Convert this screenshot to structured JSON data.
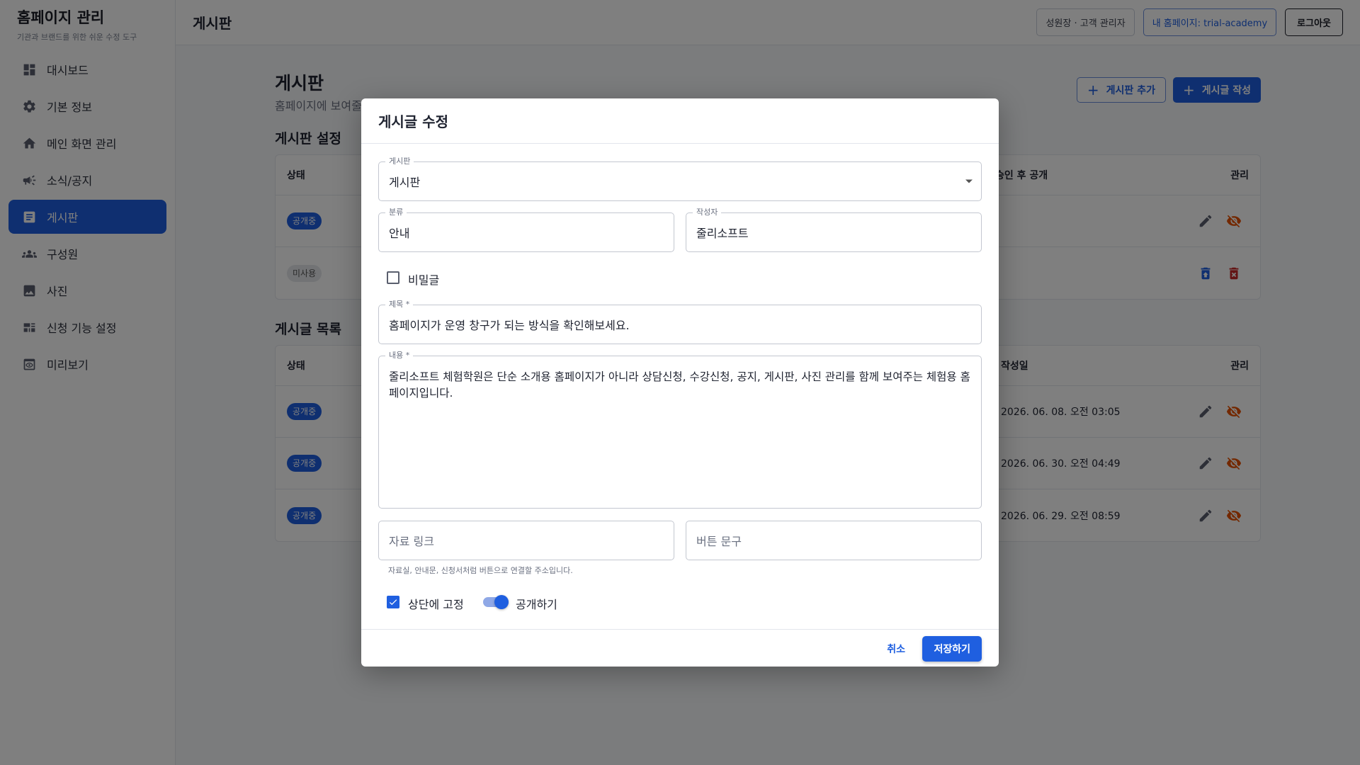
{
  "sidebar": {
    "title": "홈페이지 관리",
    "subtitle": "기관과 브랜드를 위한 쉬운 수정 도구",
    "items": [
      {
        "label": "대시보드",
        "icon": "dashboard-icon"
      },
      {
        "label": "기본 정보",
        "icon": "gear-icon"
      },
      {
        "label": "메인 화면 관리",
        "icon": "home-icon"
      },
      {
        "label": "소식/공지",
        "icon": "megaphone-icon"
      },
      {
        "label": "게시판",
        "icon": "article-icon",
        "active": true
      },
      {
        "label": "구성원",
        "icon": "people-icon"
      },
      {
        "label": "사진",
        "icon": "image-icon"
      },
      {
        "label": "신청 기능 설정",
        "icon": "form-settings-icon"
      },
      {
        "label": "미리보기",
        "icon": "preview-icon"
      }
    ]
  },
  "topbar": {
    "title": "게시판",
    "user_label": "성원장 · 고객 관리자",
    "my_site_label": "내 홈페이지: trial-academy",
    "logout_label": "로그아웃"
  },
  "page": {
    "title": "게시판",
    "description": "홈페이지에 보여줄",
    "add_board_label": "게시판 추가",
    "write_post_label": "게시글 작성"
  },
  "board_settings": {
    "title": "게시판 설정",
    "headers": {
      "status": "상태",
      "approval": "승인 후 공개",
      "manage": "관리"
    },
    "rows": [
      {
        "status": "공개중",
        "active": true
      },
      {
        "status": "미사용",
        "active": false
      }
    ]
  },
  "post_list": {
    "title": "게시글 목록",
    "headers": {
      "status": "상태",
      "created": "작성일",
      "manage": "관리"
    },
    "rows": [
      {
        "status": "공개중",
        "created": "2026. 06. 08. 오전 03:05"
      },
      {
        "status": "공개중",
        "created": "2026. 06. 30. 오전 04:49"
      },
      {
        "status": "공개중",
        "created": "2026. 06. 29. 오전 08:59"
      }
    ]
  },
  "modal": {
    "title": "게시글 수정",
    "board": {
      "label": "게시판",
      "value": "게시판"
    },
    "category": {
      "label": "분류",
      "value": "안내"
    },
    "author": {
      "label": "작성자",
      "value": "줄리소프트"
    },
    "secret_label": "비밀글",
    "subject": {
      "label": "제목 *",
      "value": "홈페이지가 운영 창구가 되는 방식을 확인해보세요."
    },
    "content": {
      "label": "내용 *",
      "value": "줄리소프트 체험학원은 단순 소개용 홈페이지가 아니라 상담신청, 수강신청, 공지, 게시판, 사진 관리를 함께 보여주는 체험용 홈페이지입니다."
    },
    "link": {
      "placeholder": "자료 링크"
    },
    "button_text": {
      "placeholder": "버튼 문구"
    },
    "helper": "자료실, 안내문, 신청서처럼 버튼으로 연결할 주소입니다.",
    "pin_label": "상단에 고정",
    "pin_checked": true,
    "publish_label": "공개하기",
    "publish_on": true,
    "cancel_label": "취소",
    "save_label": "저장하기"
  },
  "colors": {
    "primary": "#1f5fe0",
    "danger": "#c62828",
    "warning": "#e65100"
  }
}
